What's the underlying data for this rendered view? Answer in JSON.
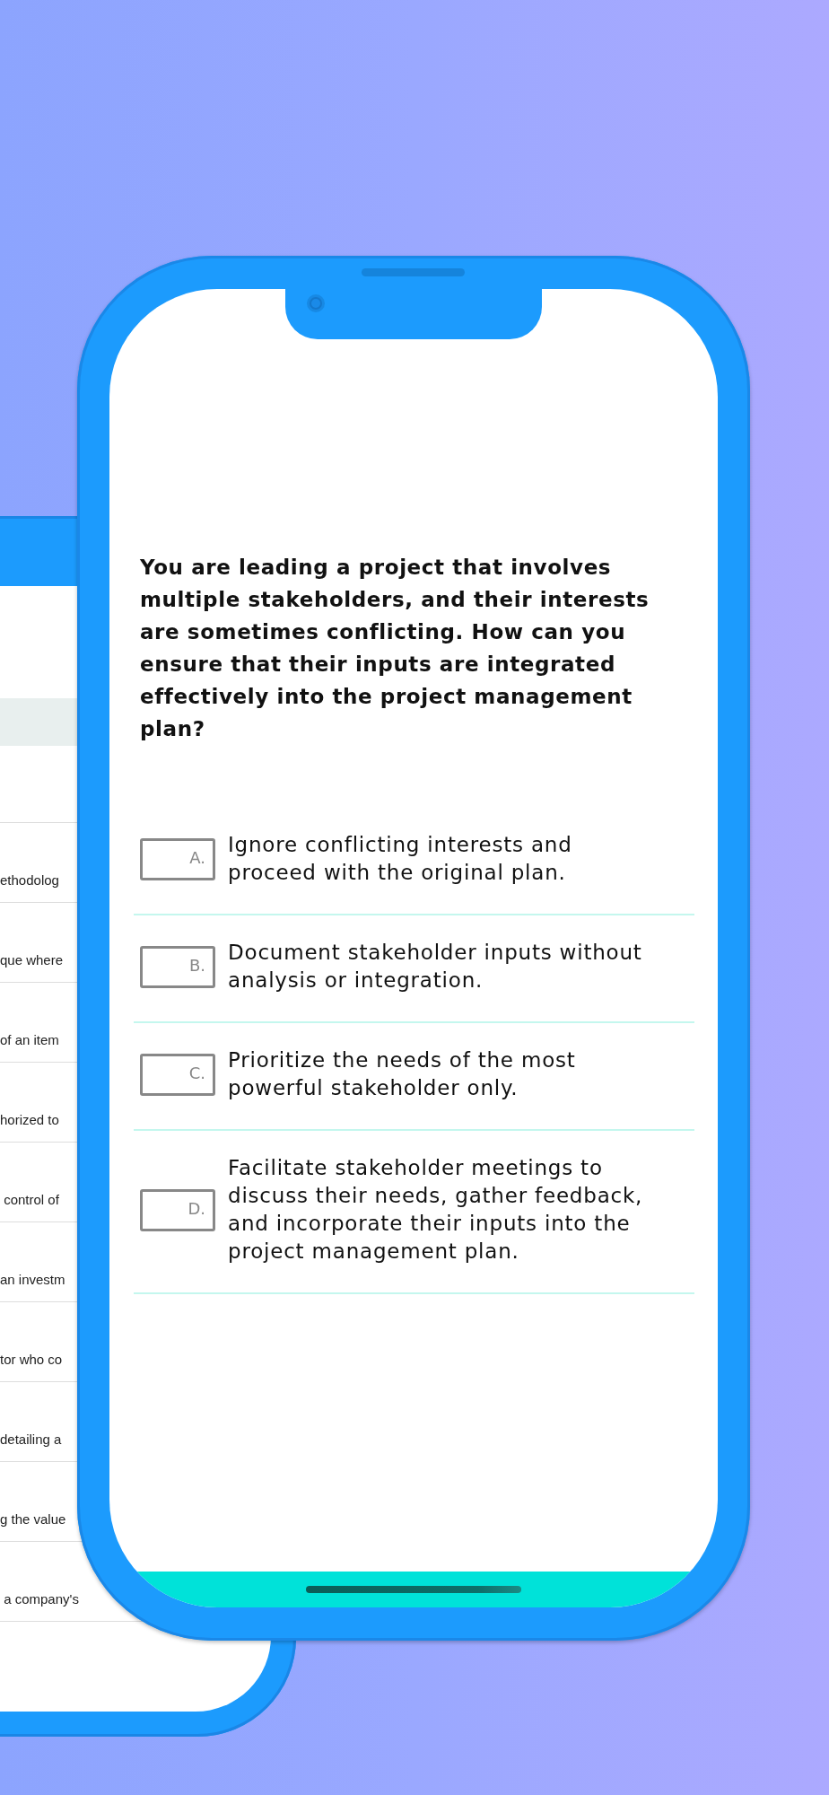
{
  "back_screen": {
    "rows": [
      {
        "text": "ethodolog"
      },
      {
        "text": "que where"
      },
      {
        "text": "of an item"
      },
      {
        "text": "horized to"
      },
      {
        "text": " control of"
      },
      {
        "text": "an investm"
      },
      {
        "text": "tor who co"
      },
      {
        "text": "detailing a"
      },
      {
        "text": "g the value"
      },
      {
        "text": " a company's"
      }
    ]
  },
  "question": "You are leading a project that involves multiple stakeholders, and their interests are sometimes conflicting. How can you ensure that their inputs are integrated effectively into the project management plan?",
  "options": [
    {
      "letter": "A.",
      "text": "Ignore conflicting interests and proceed with the original plan."
    },
    {
      "letter": "B.",
      "text": "Document stakeholder inputs without analysis or integration."
    },
    {
      "letter": "C.",
      "text": "Prioritize the needs of the most powerful stakeholder only."
    },
    {
      "letter": "D.",
      "text": "Facilitate stakeholder meetings to discuss their needs, gather feedback, and incorporate their inputs into the project management plan."
    }
  ]
}
